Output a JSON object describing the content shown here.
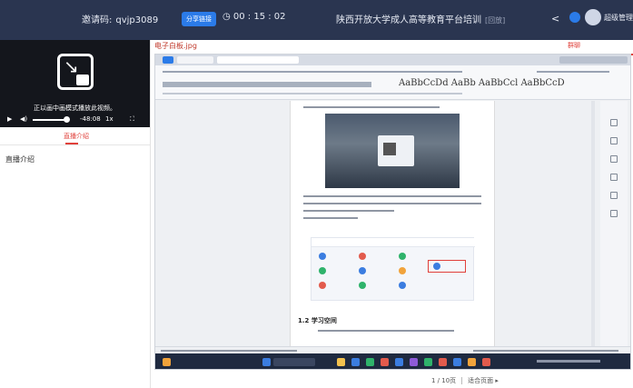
{
  "header": {
    "invite_label": "邀请码:",
    "invite_code": "qvjp3089",
    "share_button": "分享链接",
    "timer": "00 : 15 : 02",
    "title": "陕西开放大学成人高等教育平台培训",
    "status": "[回放]",
    "user_name": "超级管理员",
    "share_icon": "<"
  },
  "video": {
    "message": "正以画中画模式播放此视频。",
    "time": "-48:08",
    "rate": "1x",
    "play_icon": "▶",
    "volume_icon": "◀)",
    "fullscreen_icon": "⛶"
  },
  "left_tabs": {
    "active": "直播介绍",
    "section": "直播介绍"
  },
  "content": {
    "file_name": "电子白板.jpg",
    "right_tab": "群聊",
    "doc_styles": "AaBbCcDd AaBb AaBbCcl AaBbCcD",
    "doc_heading": "1.2 学习空间"
  },
  "pager": {
    "page": "1 / 10页",
    "adapt": "适合页面 ▸"
  },
  "colors": {
    "topbar": "#2a3550",
    "accent": "#e0403a",
    "primary": "#2b7be8"
  }
}
